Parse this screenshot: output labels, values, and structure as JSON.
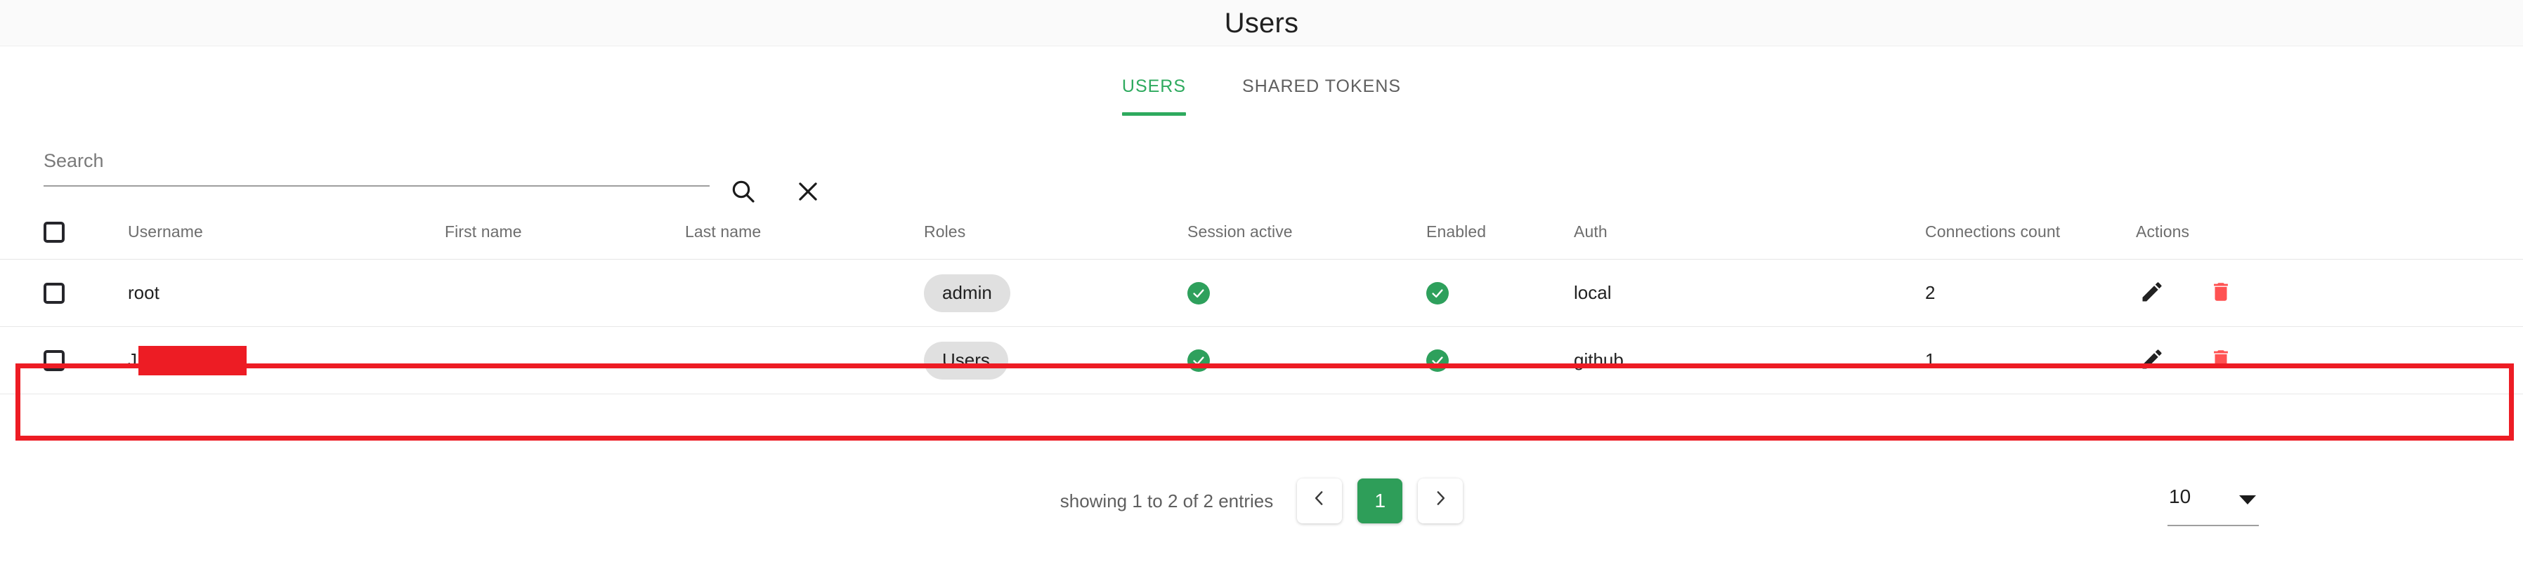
{
  "header": {
    "title": "Users"
  },
  "tabs": [
    {
      "label": "USERS",
      "active": true
    },
    {
      "label": "SHARED TOKENS",
      "active": false
    }
  ],
  "search": {
    "placeholder": "Search",
    "value": "",
    "search_icon": "search-icon",
    "clear_icon": "close-icon"
  },
  "table": {
    "columns": [
      "Username",
      "First name",
      "Last name",
      "Roles",
      "Session active",
      "Enabled",
      "Auth",
      "Connections count",
      "Actions"
    ],
    "rows": [
      {
        "selected": false,
        "username": "root",
        "username_redacted": false,
        "first_name": "",
        "last_name": "",
        "role": "admin",
        "session_active": true,
        "enabled": true,
        "auth": "local",
        "connections_count": "2",
        "edit_icon": "pencil-icon",
        "delete_icon": "trash-icon",
        "highlighted": false
      },
      {
        "selected": false,
        "username": "J",
        "username_redacted": true,
        "first_name": "",
        "last_name": "",
        "role": "Users",
        "session_active": true,
        "enabled": true,
        "auth": "github",
        "connections_count": "1",
        "edit_icon": "pencil-icon",
        "delete_icon": "trash-icon",
        "highlighted": true
      }
    ]
  },
  "footer": {
    "entries_label": "showing 1 to 2 of 2 entries",
    "prev_label": "‹",
    "current_page": "1",
    "next_label": "›",
    "rows_per_page": "10"
  },
  "colors": {
    "accent_green": "#2eaa5e",
    "page_green": "#2e9e59",
    "check_green": "#2ea05c",
    "delete_red": "#ff5252",
    "highlight_red": "#ed1c24",
    "chip_grey": "#e0e0e0",
    "header_bg": "#fafafa"
  }
}
